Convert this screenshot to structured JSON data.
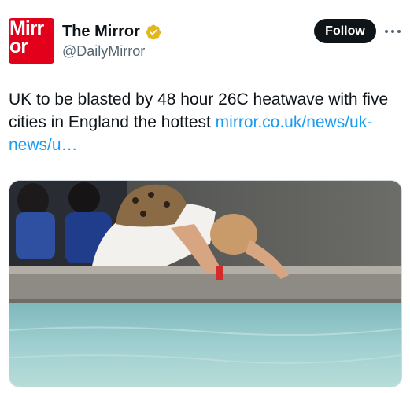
{
  "account": {
    "display_name": "The Mirror",
    "handle": "@DailyMirror",
    "avatar_logo_text": "Mirror",
    "verified_icon": "verified-badge-icon",
    "verified_color": "#e2b719"
  },
  "actions": {
    "follow_label": "Follow",
    "more_icon": "more-icon"
  },
  "tweet": {
    "text": "UK to be blasted by 48 hour 26C heatwave with five cities in England the hottest ",
    "link_text": "mirror.co.uk/​news/uk-news/u…"
  },
  "media": {
    "type": "photo"
  },
  "colors": {
    "brand_red": "#e2001a",
    "link_blue": "#1d9bf0",
    "follow_bg": "#0f1419"
  }
}
